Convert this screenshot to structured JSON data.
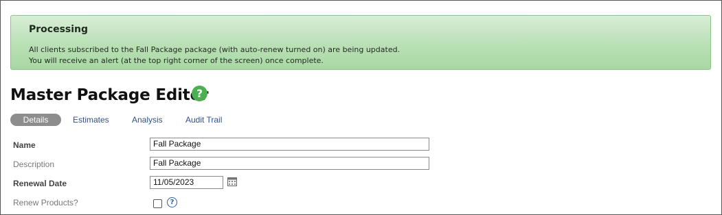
{
  "alert": {
    "title": "Processing",
    "line1": "All clients subscribed to the Fall Package package (with auto-renew turned on) are being updated.",
    "line2": "You will receive an alert (at the top right corner of the screen) once complete.",
    "color": "#b9e0b5"
  },
  "page": {
    "title": "Master Package Editor",
    "help_glyph": "?"
  },
  "tabs": [
    {
      "label": "Details",
      "active": true
    },
    {
      "label": "Estimates",
      "active": false
    },
    {
      "label": "Analysis",
      "active": false
    },
    {
      "label": "Audit Trail",
      "active": false
    }
  ],
  "form": {
    "name_label": "Name",
    "name_value": "Fall Package",
    "description_label": "Description",
    "description_value": "Fall Package",
    "renewal_label": "Renewal Date",
    "renewal_value": "11/05/2023",
    "renew_products_label": "Renew Products?",
    "renew_products_checked": false,
    "help_glyph": "?"
  },
  "icons": {
    "title_help": "question-circle-icon",
    "calendar": "calendar-icon",
    "field_help": "question-circle-outline-icon"
  }
}
